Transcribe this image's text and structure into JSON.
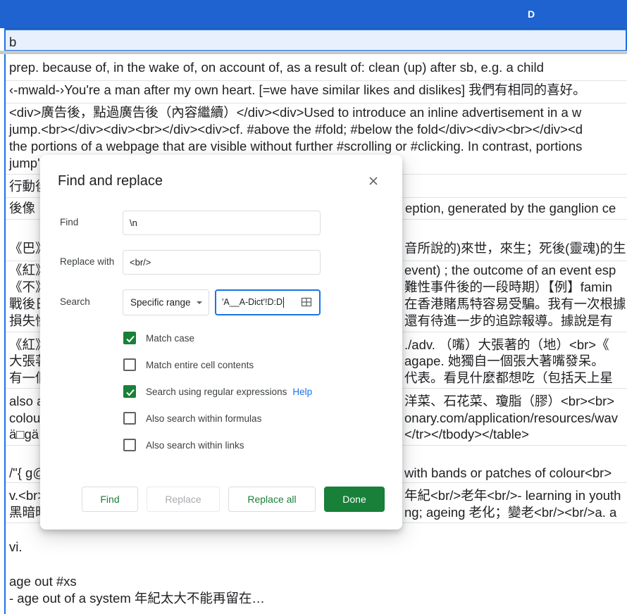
{
  "sheet": {
    "column_header": "D",
    "rows": [
      {
        "lines": [
          "b"
        ]
      },
      {
        "lines": [
          "prep. because of, in the wake of, on account of, as a result of: clean (up) after sb, e.g. a child"
        ]
      },
      {
        "lines": [
          "‹-mwald-›You're a man after my own heart. [=we have similar likes and dislikes] 我們有相同的喜好。"
        ]
      },
      {
        "lines": [
          "<div>廣告後，點過廣告後（內容繼續）</div><div>Used to introduce an inline advertisement in a w",
          "jump.<br></div><div><br></div><div>cf. #above the #fold; #below the fold</div><div><br></div><d",
          "the portions of a webpage that are visible without further #scrolling or #clicking. In contrast, portions",
          "jump'"
        ]
      },
      {
        "lines": [
          "行動後"
        ]
      },
      {
        "lines": [
          "後像",
          "eption, generated by the ganglion ce"
        ]
      },
      {
        "lines": [
          "《巴》",
          "音所說的)來世，來生；死後(靈魂)的生"
        ]
      },
      {
        "lines": [
          "《紅》",
          "event) ; the outcome of an event esp",
          "《不》",
          "難性事件後的一段時期）【例】famin",
          "戰後日",
          "在香港賭馬特容易受騙。我有一次根據",
          "損失慘",
          "還有待進一步的追踪報導。據說是有"
        ]
      },
      {
        "lines": [
          "《紅》",
          "./adv. （嘴）大張著的（地）<br>《",
          "大張著",
          "agape. 她獨自一個張大著嘴發呆。",
          "有一個",
          "代表。看見什麼都想吃（包括天上星"
        ]
      },
      {
        "lines": [
          "also a",
          "洋菜、石花菜、瓊脂（膠）<br><br>",
          "colou",
          "onary.com/application/resources/wav",
          "ä□gä",
          "</tr></tbody></table>"
        ]
      },
      {
        "lines": [
          "/\"{ g@",
          "with bands or patches of colour<br>"
        ]
      },
      {
        "lines": [
          "v.<br>",
          "年紀<br/>老年<br/>- learning in youth",
          "黑暗時",
          "ng; ageing 老化；變老<br/><br/>a. a"
        ]
      },
      {
        "lines": [
          "vi.",
          "",
          "age out #xs",
          "- age out of a system 年紀太大不能再留在…"
        ]
      }
    ]
  },
  "dialog": {
    "title": "Find and replace",
    "find_label": "Find",
    "find_value": "\\n",
    "replace_label": "Replace with",
    "replace_value": "<br/>",
    "search_label": "Search",
    "search_scope": "Specific range",
    "range_value": "'A__A-Dict'!D:D",
    "options": [
      {
        "label": "Match case",
        "checked": true
      },
      {
        "label": "Match entire cell contents",
        "checked": false
      },
      {
        "label": "Search using regular expressions",
        "checked": true,
        "link": "Help"
      },
      {
        "label": "Also search within formulas",
        "checked": false
      },
      {
        "label": "Also search within links",
        "checked": false
      }
    ],
    "buttons": {
      "find": "Find",
      "replace": "Replace",
      "replace_all": "Replace all",
      "done": "Done"
    }
  },
  "colors": {
    "header_blue": "#1f63d1",
    "accent_green": "#188038",
    "focus_blue": "#1a73e8"
  }
}
